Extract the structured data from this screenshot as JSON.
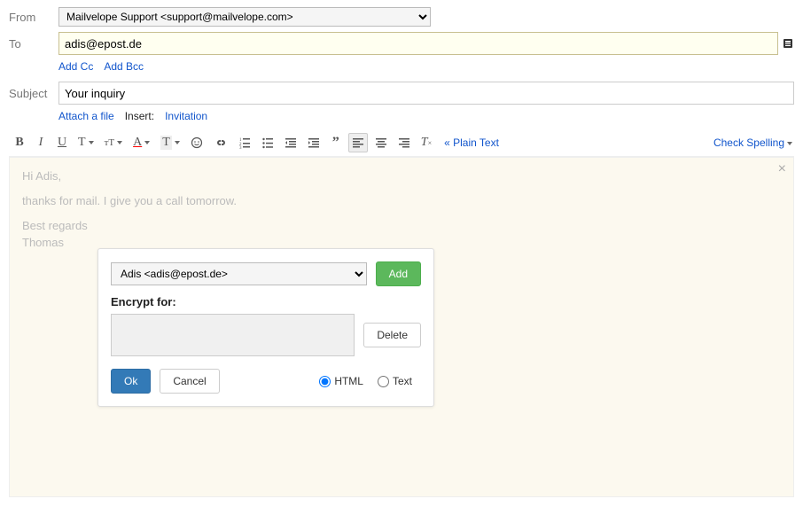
{
  "labels": {
    "from": "From",
    "to": "To",
    "subject": "Subject",
    "insert": "Insert:"
  },
  "from": {
    "selected": "Mailvelope Support <support@mailvelope.com>"
  },
  "to": {
    "value": "adis@epost.de"
  },
  "links": {
    "add_cc": "Add Cc",
    "add_bcc": "Add Bcc",
    "attach_file": "Attach a file",
    "invitation": "Invitation",
    "plain_text": "« Plain Text",
    "check_spelling": "Check Spelling"
  },
  "subject": {
    "value": "Your inquiry"
  },
  "body": {
    "line1": "Hi Adis,",
    "line2": "thanks for mail. I give you a call tomorrow.",
    "line3": "Best regards",
    "line4": "Thomas"
  },
  "dialog": {
    "recipient_selected": "Adis <adis@epost.de>",
    "add_btn": "Add",
    "encrypt_for_label": "Encrypt for:",
    "delete_btn": "Delete",
    "ok_btn": "Ok",
    "cancel_btn": "Cancel",
    "format_html": "HTML",
    "format_text": "Text"
  }
}
